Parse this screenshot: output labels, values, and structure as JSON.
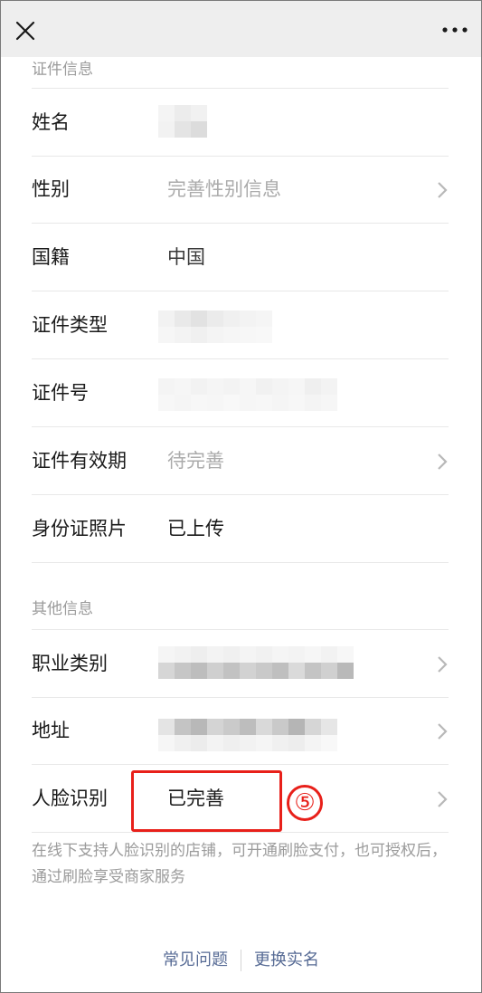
{
  "section_id": {
    "title": "证件信息"
  },
  "rows_id": [
    {
      "label": "姓名",
      "value": "",
      "hint": false,
      "chevron": false
    },
    {
      "label": "性别",
      "value": "完善性别信息",
      "hint": true,
      "chevron": true
    },
    {
      "label": "国籍",
      "value": "中国",
      "hint": false,
      "chevron": false
    },
    {
      "label": "证件类型",
      "value": "",
      "hint": false,
      "chevron": false
    },
    {
      "label": "证件号",
      "value": "",
      "hint": false,
      "chevron": false
    },
    {
      "label": "证件有效期",
      "value": "待完善",
      "hint": true,
      "chevron": true
    },
    {
      "label": "身份证照片",
      "value": "已上传",
      "hint": false,
      "chevron": false
    }
  ],
  "section_other": {
    "title": "其他信息"
  },
  "rows_other": [
    {
      "label": "职业类别",
      "value": "",
      "chevron": true
    },
    {
      "label": "地址",
      "value": "",
      "chevron": true
    },
    {
      "label": "人脸识别",
      "value": "已完善",
      "chevron": true
    }
  ],
  "note": "在线下支持人脸识别的店铺，可开通刷脸支付，也可授权后，通过刷脸享受商家服务",
  "annotation": {
    "step": "⑤",
    "color": "#e8201a"
  },
  "footer": {
    "faq": "常见问题",
    "change_name": "更换实名"
  },
  "colors": {
    "link": "#576b95",
    "hint": "#ababab",
    "divider": "#e8e8e8"
  }
}
